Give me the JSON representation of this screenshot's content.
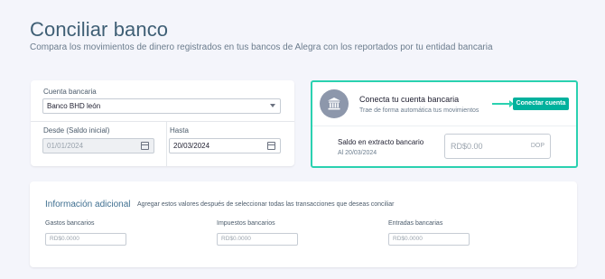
{
  "page": {
    "title": "Conciliar banco",
    "subtitle": "Compara los movimientos de dinero registrados en tus bancos de Alegra con los reportados por tu entidad bancaria"
  },
  "bank_form": {
    "account_label": "Cuenta bancaria",
    "account_value": "Banco BHD león",
    "from_label": "Desde (Saldo inicial)",
    "from_value": "01/01/2024",
    "to_label": "Hasta",
    "to_value": "20/03/2024"
  },
  "connect": {
    "title": "Conecta tu cuenta bancaria",
    "subtitle": "Trae de forma automática tus movimientos",
    "button_label": "Conectar cuenta",
    "accent_color": "#2ad1b0",
    "balance_title": "Saldo en extracto bancario",
    "balance_date": "Al 20/03/2024",
    "balance_placeholder": "RD$0.00",
    "currency": "DOP"
  },
  "info": {
    "title": "Información adicional",
    "subtitle": "Agregar estos valores después de seleccionar todas las transacciones que deseas conciliar",
    "fields": [
      {
        "label": "Gastos bancarios",
        "placeholder": "RD$0.0000"
      },
      {
        "label": "Impuestos bancarios",
        "placeholder": "RD$0.0000"
      },
      {
        "label": "Entradas bancarias",
        "placeholder": "RD$0.0000"
      }
    ]
  }
}
